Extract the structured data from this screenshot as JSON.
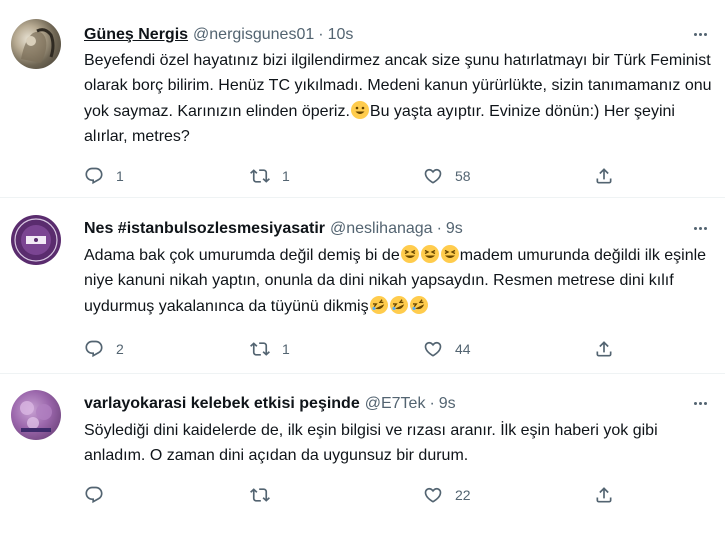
{
  "tweets": [
    {
      "name": "Güneş Nergis",
      "handle": "@nergisgunes01",
      "separator": "·",
      "time": "10s",
      "text_parts": [
        "Beyefendi özel hayatınız bizi ilgilendirmez ancak size şunu hatırlatmayı bir Türk Feminist olarak borç bilirim. Henüz TC yıkılmadı. Medeni kanun yürürlükte, sizin tanımamanız onu yok saymaz. Karınızın elinden öperiz.",
        "Bu yaşta ayıptır. Evinize dönün:) Her şeyini alırlar, metres?"
      ],
      "emojis": [
        "grinning-face"
      ],
      "replies": "1",
      "retweets": "1",
      "likes": "58"
    },
    {
      "name": "Nes #istanbulsozlesmesiyasatir",
      "handle": "@neslihanaga",
      "separator": "·",
      "time": "9s",
      "text_parts": [
        "Adama bak çok umurumda değil demiş bi de",
        "madem umurunda değildi ilk eşinle niye kanuni nikah yaptın, onunla da dini nikah yapsaydın. Resmen metrese dini kılıf uydurmuş yakalanınca da tüyünü dikmiş"
      ],
      "emojis": [
        "grinning-squinting-face",
        "grinning-squinting-face",
        "grinning-squinting-face",
        "rolling-laughing-face",
        "rolling-laughing-face",
        "rolling-laughing-face"
      ],
      "replies": "2",
      "retweets": "1",
      "likes": "44"
    },
    {
      "name": "varlayokarasi kelebek etkisi peşinde",
      "handle": "@E7Tek",
      "separator": "·",
      "time": "9s",
      "text_parts": [
        "Söylediği dini kaidelerde de, ilk eşin bilgisi ve rızası aranır. İlk eşin haberi yok gibi anladım. O zaman dini açıdan da uygunsuz bir durum."
      ],
      "emojis": [],
      "replies": "",
      "retweets": "",
      "likes": "22"
    }
  ],
  "icons": {
    "reply": "reply-icon",
    "retweet": "retweet-icon",
    "like": "like-icon",
    "share": "share-icon",
    "more": "more-icon"
  },
  "colors": {
    "text": "#0f1419",
    "secondary": "#536471",
    "divider": "#eff3f4",
    "emoji": "#ffcc4d"
  }
}
